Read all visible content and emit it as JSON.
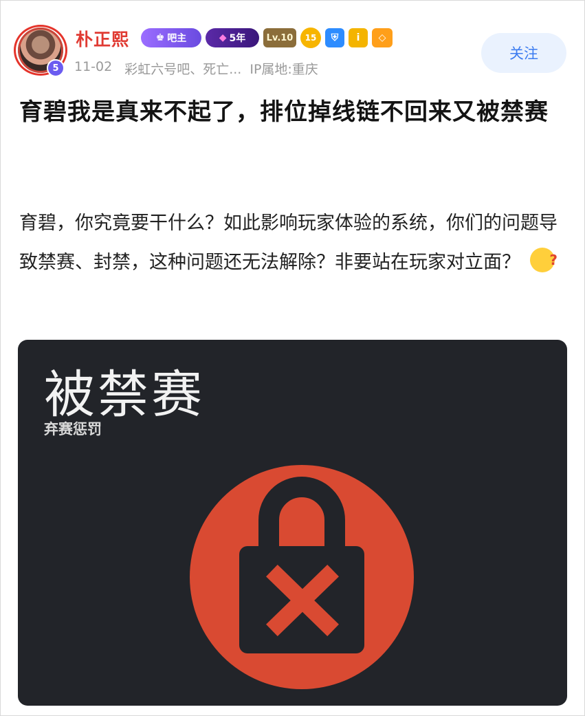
{
  "post": {
    "author": {
      "name": "朴正熙",
      "level_dot": "5"
    },
    "badges": {
      "admin": "吧主",
      "years": "5年",
      "level": "Lv.10",
      "coin": "15"
    },
    "meta": {
      "date": "11-02",
      "forums": "彩虹六号吧、死亡...",
      "ip": "IP属地:重庆"
    },
    "follow_label": "关注",
    "title": "育碧我是真来不起了，排位掉线链不回来又被禁赛",
    "body": "育碧，你究竟要干什么？如此影响玩家体验的系统，你们的问题导致禁赛、封禁，这种问题还无法解除？非要站在玩家对立面？",
    "emoji": "thinking-face-emoji",
    "image": {
      "heading": "被禁赛",
      "subheading": "弃赛惩罚",
      "icon": "lock-x-icon",
      "circle_color": "#d94a32",
      "background": "#222429"
    }
  },
  "colors": {
    "username": "#e03b33",
    "follow_text": "#3c7cf0",
    "follow_bg": "#eaf2fe"
  }
}
